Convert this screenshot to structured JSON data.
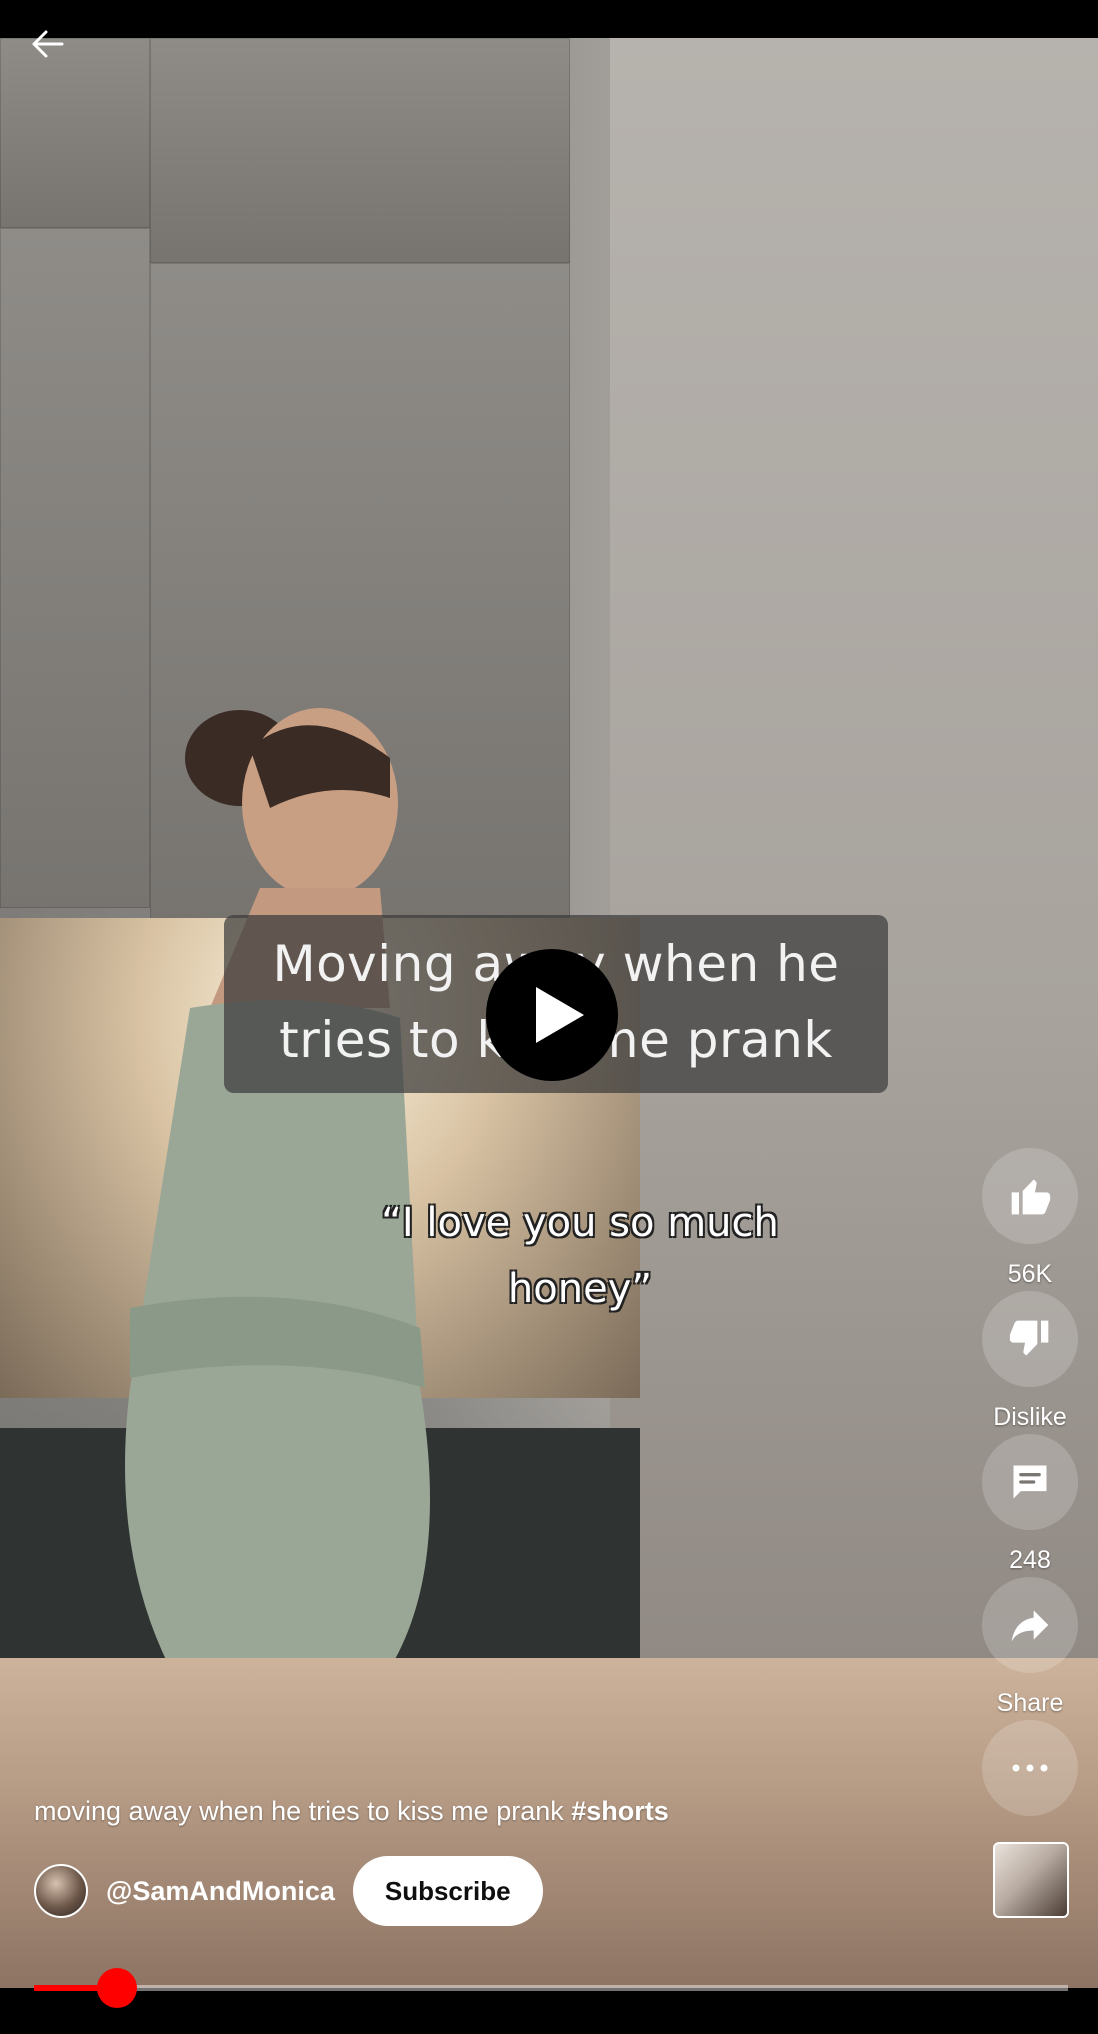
{
  "video": {
    "overlay_caption_line1": "Moving away when he",
    "overlay_caption_line2": "tries to kiss me prank",
    "subtitle_line1": "“I love you so much",
    "subtitle_line2": "honey”"
  },
  "actions": {
    "like_count": "56K",
    "dislike_label": "Dislike",
    "comment_count": "248",
    "share_label": "Share"
  },
  "meta": {
    "title_text": "moving away when he tries to kiss me prank ",
    "title_hashtag": "#shorts",
    "channel_name": "@SamAndMonica",
    "subscribe_label": "Subscribe"
  },
  "playback": {
    "progress_fraction": 0.08
  },
  "icons": {
    "back": "arrow-left-icon",
    "play": "play-icon",
    "like": "thumb-up-icon",
    "dislike": "thumb-down-icon",
    "comment": "comment-icon",
    "share": "share-icon",
    "more": "more-horizontal-icon"
  },
  "colors": {
    "progress": "#ff0000",
    "subscribe_bg": "#ffffff"
  }
}
